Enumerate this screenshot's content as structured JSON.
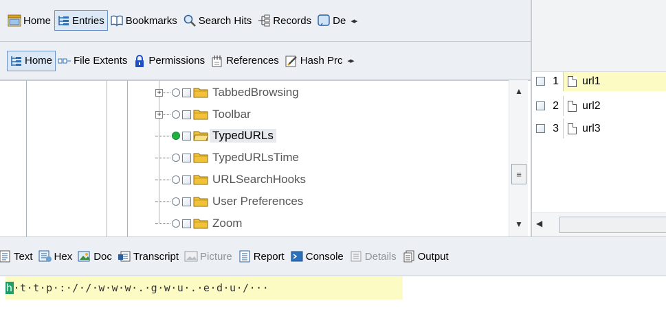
{
  "top_toolbar": {
    "items": [
      {
        "label": "Home",
        "icon": "home-icon",
        "active": false
      },
      {
        "label": "Entries",
        "icon": "tree-icon",
        "active": true
      },
      {
        "label": "Bookmarks",
        "icon": "book-icon",
        "active": false
      },
      {
        "label": "Search Hits",
        "icon": "magnifier-icon",
        "active": false
      },
      {
        "label": "Records",
        "icon": "records-icon",
        "active": false
      },
      {
        "label": "De",
        "icon": "details-icon",
        "active": false
      }
    ]
  },
  "sub_toolbar": {
    "items": [
      {
        "label": "Home",
        "icon": "tree-icon",
        "active": true
      },
      {
        "label": "File Extents",
        "icon": "extents-icon",
        "active": false
      },
      {
        "label": "Permissions",
        "icon": "lock-icon",
        "active": false
      },
      {
        "label": "References",
        "icon": "references-icon",
        "active": false
      },
      {
        "label": "Hash Prc",
        "icon": "hash-icon",
        "active": false
      }
    ]
  },
  "tree": {
    "items": [
      {
        "label": "TabbedBrowsing",
        "expandable": true,
        "selected": false
      },
      {
        "label": "Toolbar",
        "expandable": true,
        "selected": false
      },
      {
        "label": "TypedURLs",
        "expandable": false,
        "selected": true
      },
      {
        "label": "TypedURLsTime",
        "expandable": false,
        "selected": false
      },
      {
        "label": "URLSearchHooks",
        "expandable": false,
        "selected": false
      },
      {
        "label": "User Preferences",
        "expandable": false,
        "selected": false
      },
      {
        "label": "Zoom",
        "expandable": false,
        "selected": false
      }
    ]
  },
  "table": {
    "rows": [
      {
        "num": "1",
        "name": "url1",
        "highlighted": true
      },
      {
        "num": "2",
        "name": "url2",
        "highlighted": false
      },
      {
        "num": "3",
        "name": "url3",
        "highlighted": false
      }
    ]
  },
  "bottom_toolbar": {
    "items": [
      {
        "label": "Text",
        "icon": "text-icon",
        "disabled": false
      },
      {
        "label": "Hex",
        "icon": "hex-icon",
        "disabled": false
      },
      {
        "label": "Doc",
        "icon": "doc-icon",
        "disabled": false
      },
      {
        "label": "Transcript",
        "icon": "transcript-icon",
        "disabled": false
      },
      {
        "label": "Picture",
        "icon": "picture-icon",
        "disabled": true
      },
      {
        "label": "Report",
        "icon": "report-icon",
        "disabled": false
      },
      {
        "label": "Console",
        "icon": "console-icon",
        "disabled": false
      },
      {
        "label": "Details",
        "icon": "details-icon",
        "disabled": true
      },
      {
        "label": "Output",
        "icon": "output-icon",
        "disabled": false
      }
    ]
  },
  "content": {
    "caret_char": "h",
    "text": "·t·t·p·:·/·/·w·w·w·.·g·w·u·.·e·d·u·/···"
  },
  "colors": {
    "highlight": "#fdfbc4",
    "active_button": "#dce8f6",
    "caret": "#1e9e68",
    "folder": "#f3c13a"
  }
}
